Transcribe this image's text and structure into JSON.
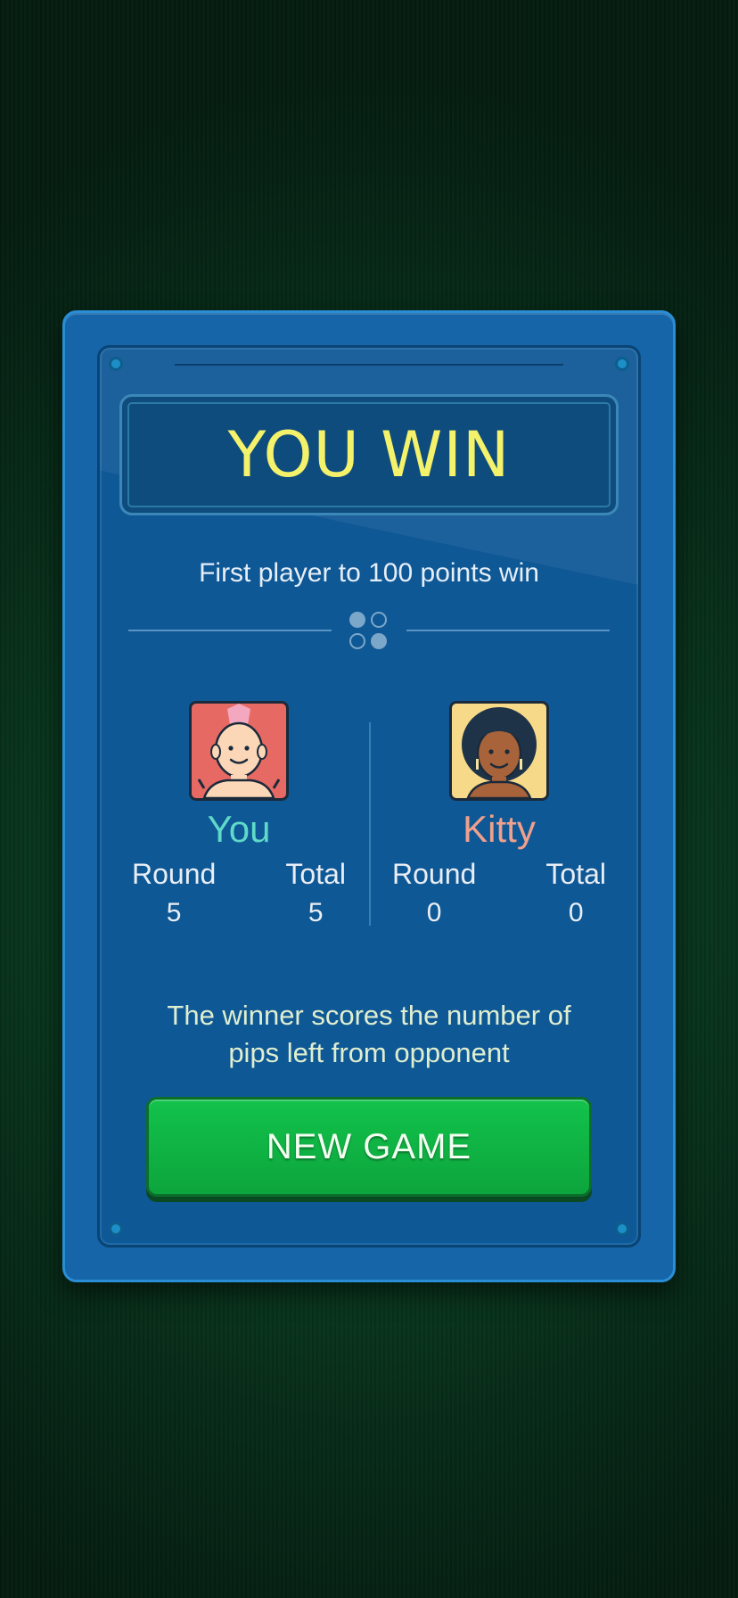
{
  "dialog": {
    "title": "YOU WIN",
    "subtitle": "First player to 100 points win",
    "note": "The winner scores the number of pips left from opponent",
    "button_label": "NEW GAME"
  },
  "players": [
    {
      "name": "You",
      "name_color": "#5fd9c8",
      "avatar_bg": "#e66a63",
      "round_label": "Round",
      "round_value": "5",
      "total_label": "Total",
      "total_value": "5"
    },
    {
      "name": "Kitty",
      "name_color": "#f0a08c",
      "avatar_bg": "#f7d98a",
      "round_label": "Round",
      "round_value": "0",
      "total_label": "Total",
      "total_value": "0"
    }
  ],
  "colors": {
    "title": "#f4f16a",
    "button": "#12b84a",
    "panel": "#1565a8"
  }
}
